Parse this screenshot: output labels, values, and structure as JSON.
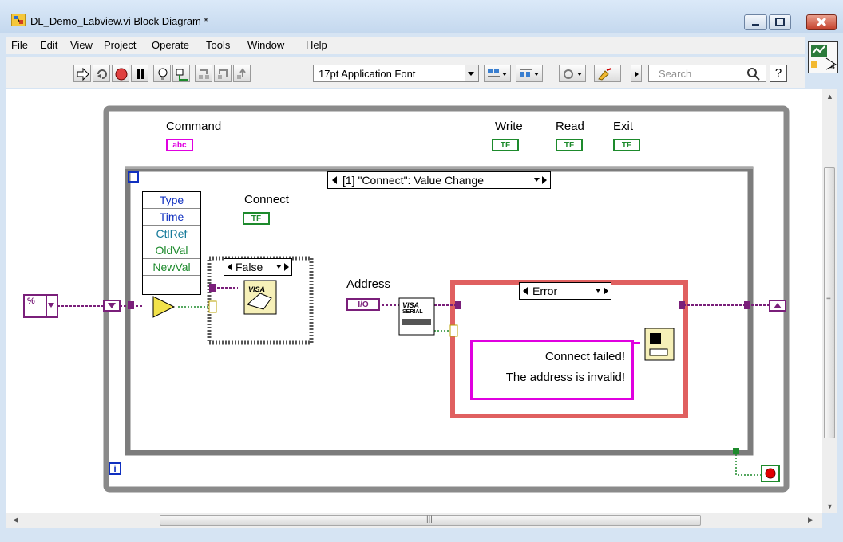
{
  "window": {
    "title": "DL_Demo_Labview.vi Block Diagram *"
  },
  "menu": [
    "File",
    "Edit",
    "View",
    "Project",
    "Operate",
    "Tools",
    "Window",
    "Help"
  ],
  "toolbar": {
    "font": "17pt Application Font",
    "search_placeholder": "Search",
    "help": "?"
  },
  "vi_icon": {
    "connector_count": "4"
  },
  "diagram": {
    "controls": {
      "command": "Command",
      "write": "Write",
      "read": "Read",
      "exit": "Exit",
      "connect": "Connect",
      "address": "Address"
    },
    "terminals": {
      "string": "abc",
      "bool": "TF",
      "io": "I/O"
    },
    "event_structure": {
      "selector": "[1] \"Connect\": Value Change"
    },
    "event_data_nodes": [
      "Type",
      "Time",
      "CtlRef",
      "OldVal",
      "NewVal"
    ],
    "case_false": {
      "selector": "False"
    },
    "case_error": {
      "selector": "Error"
    },
    "visa_label": "VISA",
    "visa_serial_label": "SERIAL",
    "message": {
      "line1": "Connect failed!",
      "line2": "The address is invalid!"
    },
    "iteration_terminal": "i",
    "shift_register_label": "%"
  },
  "colors": {
    "bool": "#1d8a2c",
    "string": "#e000e0",
    "io": "#7a1f7a",
    "loop": "#8a8a8a",
    "error_frame": "#e06060",
    "stop": "#e00000"
  }
}
